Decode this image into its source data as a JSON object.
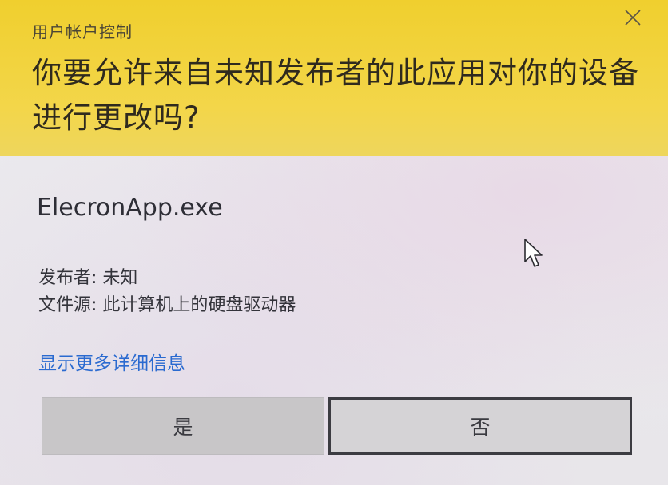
{
  "dialog": {
    "header": {
      "title": "用户帐户控制",
      "question": "你要允许来自未知发布者的此应用对你的设备进行更改吗?",
      "close_icon": "close-icon"
    },
    "app_name": "ElecronApp.exe",
    "publisher_line": "发布者: 未知",
    "source_line": "文件源: 此计算机上的硬盘驱动器",
    "details_link": "显示更多详细信息",
    "buttons": {
      "yes_label": "是",
      "no_label": "否"
    },
    "colors": {
      "header_yellow": "#f3d64a",
      "link_blue": "#2a6ad0",
      "no_button_border": "#3c3c42"
    }
  }
}
